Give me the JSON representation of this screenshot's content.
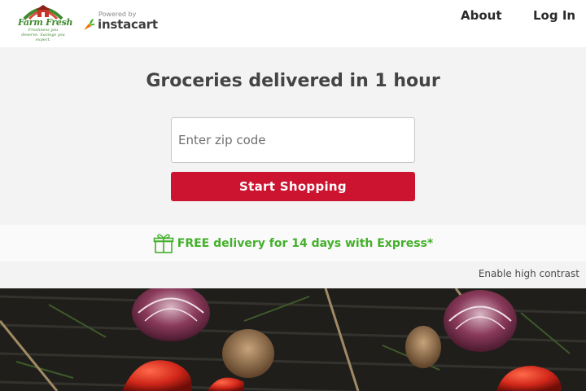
{
  "header": {
    "brand": {
      "name": "Farm Fresh",
      "tagline": "Freshness you deserve. Savings you expect."
    },
    "powered_by": "Powered by",
    "partner": "instacart",
    "nav": {
      "about": "About",
      "login": "Log In"
    }
  },
  "hero": {
    "title": "Groceries delivered in 1 hour",
    "zip_placeholder": "Enter zip code",
    "zip_value": "",
    "cta_label": "Start Shopping"
  },
  "promo": {
    "text": "FREE delivery for 14 days with Express*",
    "icon": "gift-icon"
  },
  "accessibility": {
    "high_contrast_label": "Enable high contrast"
  },
  "colors": {
    "brand_green": "#3f8a2c",
    "instacart_green": "#43b02a",
    "cta_red": "#cc1330",
    "hero_bg": "#f3f3f3",
    "title_gray": "#444444"
  }
}
